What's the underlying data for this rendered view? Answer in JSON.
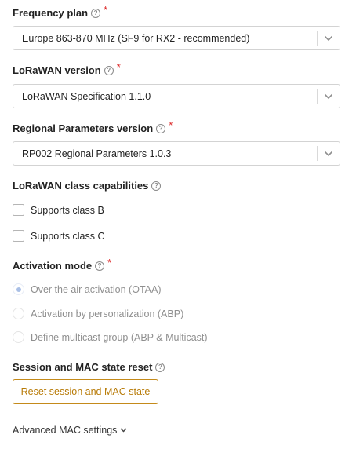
{
  "frequency_plan": {
    "label": "Frequency plan",
    "help": "?",
    "required": "*",
    "value": "Europe 863-870 MHz (SF9 for RX2 - recommended)"
  },
  "lorawan_version": {
    "label": "LoRaWAN version",
    "help": "?",
    "required": "*",
    "value": "LoRaWAN Specification 1.1.0"
  },
  "regional_parameters": {
    "label": "Regional Parameters version",
    "help": "?",
    "required": "*",
    "value": "RP002 Regional Parameters 1.0.3"
  },
  "class_capabilities": {
    "label": "LoRaWAN class capabilities",
    "help": "?",
    "options": [
      {
        "label": "Supports class B",
        "checked": false
      },
      {
        "label": "Supports class C",
        "checked": false
      }
    ]
  },
  "activation_mode": {
    "label": "Activation mode",
    "help": "?",
    "required": "*",
    "options": [
      {
        "label": "Over the air activation (OTAA)",
        "selected": true
      },
      {
        "label": "Activation by personalization (ABP)",
        "selected": false
      },
      {
        "label": "Define multicast group (ABP & Multicast)",
        "selected": false
      }
    ]
  },
  "session_reset": {
    "label": "Session and MAC state reset",
    "help": "?",
    "button_label": "Reset session and MAC state"
  },
  "advanced": {
    "label": "Advanced MAC settings",
    "icon": "chevron-down-icon"
  },
  "colors": {
    "required": "#db2323",
    "reset_button": "#c48a1a",
    "radio_disabled": "#a9bfe6"
  }
}
